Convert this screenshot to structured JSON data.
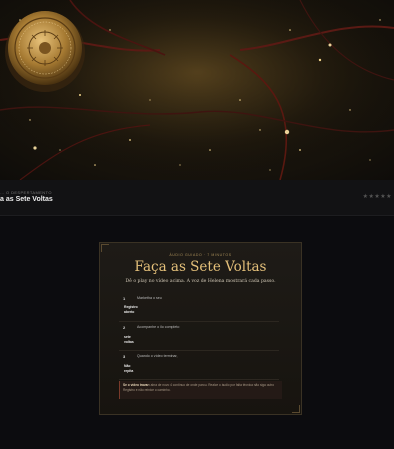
{
  "header": {
    "breadcrumb": "... O DESPERTAMENTO",
    "lesson_title": "a as Sete Voltas",
    "rating_stars": "★★★★★"
  },
  "card": {
    "kicker": "ÁUDIO GUIADO · 7 MINUTOS",
    "title": "Faça as Sete Voltas",
    "subtitle": "Dê o play no vídeo acima. A voz de Helena mostrará cada passo.",
    "steps": [
      {
        "num": "1",
        "text": "Marketha o seu",
        "status_line1": "Registro",
        "status_line2": "aberto"
      },
      {
        "num": "2",
        "text": "Acompanhe o ilo completo",
        "status_line1": "sete",
        "status_line2": "voltas"
      },
      {
        "num": "3",
        "text": "Quando o vídeo terminar,",
        "status_line1": "Não",
        "status_line2": "repita"
      }
    ],
    "note_bold": "Se o vídeo travar:",
    "note_text": "abra de novo 4 contínuo de onde parou. Realce o áudio por falta técnica não siga outro Registro e não reinice o caminho."
  },
  "colors": {
    "accent_gold": "#e4c07a",
    "card_border": "#3a3224",
    "note_accent": "#7a3a2a"
  }
}
